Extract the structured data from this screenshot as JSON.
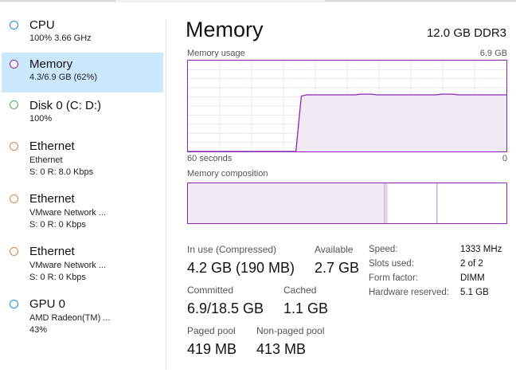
{
  "colors": {
    "memory_accent": "#8b26b6",
    "cpu_dot": "#1a8fd6",
    "disk_dot": "#4db84d",
    "ethernet_dot": "#d9844a",
    "gpu_dot": "#1a8fd6",
    "selected_bg": "#cce8ff"
  },
  "sidebar": {
    "items": [
      {
        "title": "CPU",
        "sub1": "100%  3.66 GHz",
        "sub2": ""
      },
      {
        "title": "Memory",
        "sub1": "4.3/6.9 GB (62%)",
        "sub2": "",
        "selected": true
      },
      {
        "title": "Disk 0 (C: D:)",
        "sub1": "100%",
        "sub2": ""
      },
      {
        "title": "Ethernet",
        "sub1": "Ethernet",
        "sub2": "S: 0  R: 8.0 Kbps"
      },
      {
        "title": "Ethernet",
        "sub1": "VMware Network ...",
        "sub2": "S: 0  R: 0 Kbps"
      },
      {
        "title": "Ethernet",
        "sub1": "VMware Network ...",
        "sub2": "S: 0  R: 0 Kbps"
      },
      {
        "title": "GPU 0",
        "sub1": "AMD Radeon(TM) ...",
        "sub2": "43%"
      }
    ]
  },
  "header": {
    "title": "Memory",
    "spec": "12.0 GB DDR3"
  },
  "usage_chart": {
    "label": "Memory usage",
    "max_label": "6.9 GB",
    "x_left_label": "60 seconds",
    "x_right_label": "0",
    "max_gb": 6.9,
    "series_gb": [
      0,
      0,
      0,
      0,
      0,
      0,
      0,
      0,
      0,
      0,
      0,
      0,
      0,
      0,
      0,
      0,
      0,
      0,
      0,
      0,
      0,
      4.2,
      4.3,
      4.3,
      4.3,
      4.3,
      4.3,
      4.3,
      4.3,
      4.3,
      4.3,
      4.3,
      4.35,
      4.35,
      4.35,
      4.3,
      4.3,
      4.3,
      4.3,
      4.3,
      4.3,
      4.3,
      4.3,
      4.3,
      4.3,
      4.3,
      4.3,
      4.35,
      4.35,
      4.35,
      4.3,
      4.3,
      4.3,
      4.3,
      4.3,
      4.3,
      4.3,
      4.3,
      4.3,
      4.3
    ]
  },
  "composition": {
    "label": "Memory composition",
    "in_use_fraction": 0.617,
    "modified_fraction": 0.01,
    "standby_fraction": 0.155,
    "free_fraction": 0.218
  },
  "stats": {
    "in_use_label": "In use (Compressed)",
    "in_use_value": "4.2 GB (190 MB)",
    "available_label": "Available",
    "available_value": "2.7 GB",
    "committed_label": "Committed",
    "committed_value": "6.9/18.5 GB",
    "cached_label": "Cached",
    "cached_value": "1.1 GB",
    "paged_label": "Paged pool",
    "paged_value": "419 MB",
    "nonpaged_label": "Non-paged pool",
    "nonpaged_value": "413 MB"
  },
  "details": {
    "speed_label": "Speed:",
    "speed_value": "1333 MHz",
    "slots_label": "Slots used:",
    "slots_value": "2 of 2",
    "form_label": "Form factor:",
    "form_value": "DIMM",
    "reserved_label": "Hardware reserved:",
    "reserved_value": "5.1 GB"
  }
}
